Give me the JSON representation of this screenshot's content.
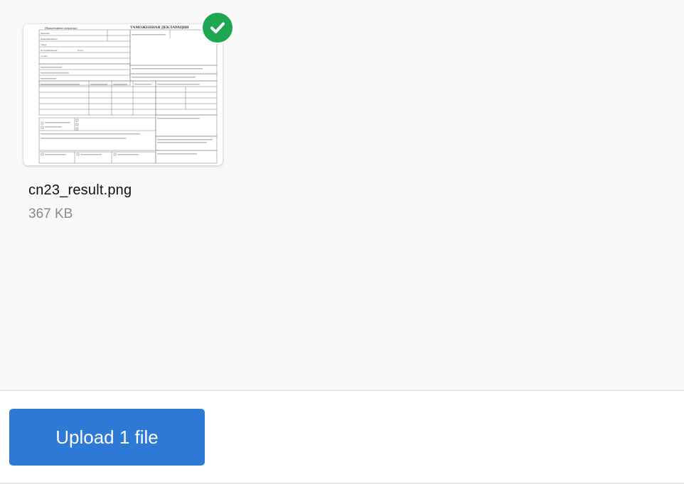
{
  "file": {
    "name": "cn23_result.png",
    "size": "367 KB",
    "status": "uploaded",
    "thumbnail": {
      "title": "ТАМОЖЕННАЯ ДЕКЛАРАЦИЯ",
      "header_note": "(Наименование оператора)",
      "rows": [
        "Фамилия",
        "Компания/Фирма",
        "Улица",
        "Почтовый индекс",
        "Город",
        "Страна"
      ],
      "icons": [
        "customs-form-preview"
      ]
    }
  },
  "colors": {
    "accent": "#2e78d6",
    "success": "#1fa652"
  },
  "footer": {
    "upload_label": "Upload 1 file"
  }
}
